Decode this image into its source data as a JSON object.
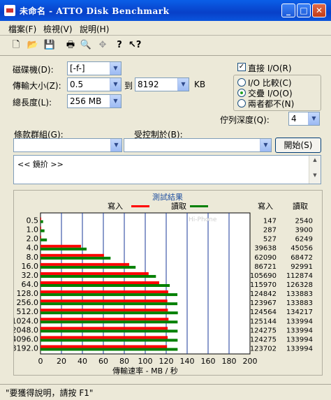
{
  "window": {
    "title": "未命名 - ATTO Disk Benchmark"
  },
  "menu": {
    "file": "檔案(F)",
    "view": "檢視(V)",
    "help": "說明(H)"
  },
  "toolbar_icons": [
    "new-icon",
    "open-icon",
    "save-icon",
    "print-icon",
    "print-preview-icon",
    "move-icon",
    "help-icon",
    "context-help-icon"
  ],
  "form": {
    "drive_label": "磁碟機(D):",
    "drive_value": "[-f-]",
    "transfer_label": "傳輸大小(Z):",
    "transfer_from": "0.5",
    "to_label": "到",
    "transfer_to": "8192",
    "kb_label": "KB",
    "length_label": "總長度(L):",
    "length_value": "256 MB",
    "direct_io_label": "直接 I/O(R)",
    "direct_io_checked": true,
    "io_compare_label": "I/O 比較(C)",
    "overlap_io_label": "交疊 I/O(O)",
    "neither_label": "兩者都不(N)",
    "queue_label": "佇列深度(Q):",
    "queue_value": "4",
    "group_label": "條款群組(G):",
    "controlled_label": "受控制於(B):",
    "start_button": "開始(S)",
    "log_text": "<< 鏡扴 >>"
  },
  "chart_data": {
    "type": "bar",
    "title": "測試結果",
    "xlabel": "傳輸速率 - MB / 秒",
    "legend": [
      {
        "name": "寫入",
        "color": "#ff0000"
      },
      {
        "name": "讀取",
        "color": "#008000"
      }
    ],
    "legend_placement": "top",
    "xlim": [
      0,
      200
    ],
    "xticks": [
      "0",
      "20",
      "40",
      "60",
      "80",
      "100",
      "120",
      "140",
      "160",
      "180",
      "200"
    ],
    "categories": [
      "0.5",
      "1.0",
      "2.0",
      "4.0",
      "8.0",
      "16.0",
      "32.0",
      "64.0",
      "128.0",
      "256.0",
      "512.0",
      "1024.0",
      "2048.0",
      "4096.0",
      "8192.0"
    ],
    "write_kbps": [
      147,
      287,
      527,
      39638,
      62090,
      86721,
      105690,
      115970,
      124842,
      123967,
      124564,
      125144,
      124275,
      124275,
      123702
    ],
    "read_kbps": [
      2540,
      3900,
      6249,
      45056,
      68472,
      92991,
      112874,
      126328,
      133883,
      133883,
      134217,
      133994,
      133994,
      133994,
      133994
    ],
    "series": [
      {
        "name": "寫入",
        "values": [
          0.14,
          0.28,
          0.51,
          38.7,
          60.6,
          84.7,
          103.2,
          113.3,
          121.9,
          121.1,
          121.6,
          122.2,
          121.4,
          121.4,
          120.8
        ]
      },
      {
        "name": "讀取",
        "values": [
          2.5,
          3.8,
          6.1,
          44.0,
          66.9,
          90.8,
          110.2,
          123.4,
          130.7,
          130.7,
          131.1,
          130.9,
          130.9,
          130.9,
          130.9
        ]
      }
    ],
    "write_header": "寫入",
    "read_header": "讀取",
    "grid": true,
    "watermark": "Hi-Phone"
  },
  "status": {
    "text": "\"要獲得說明，請按 F1\""
  }
}
